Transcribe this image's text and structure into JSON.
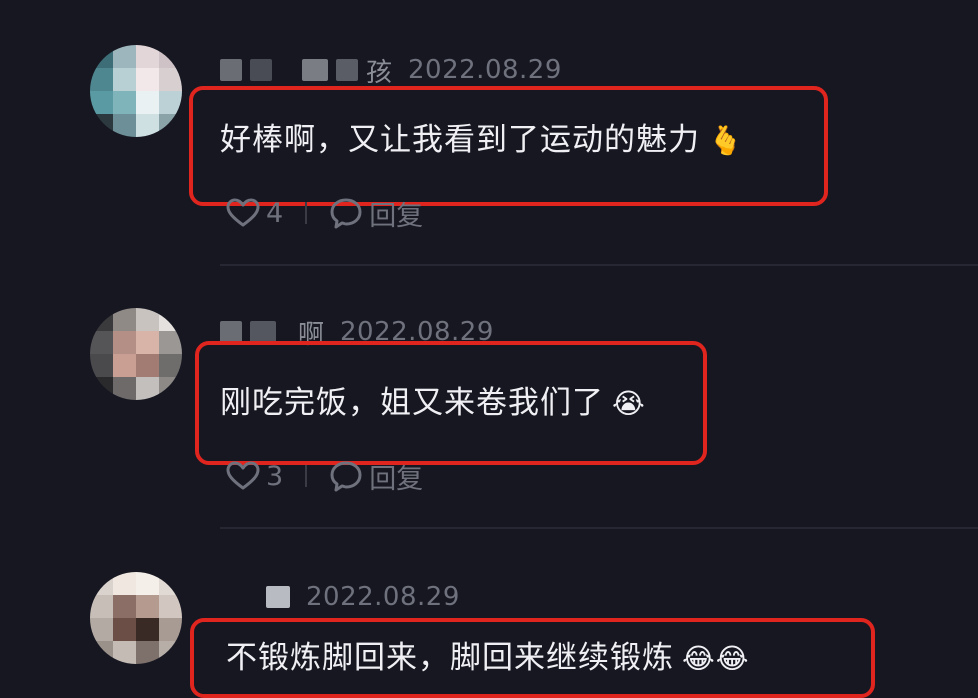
{
  "comments": [
    {
      "username_visible": "孩",
      "date": "2022.08.29",
      "text": "好棒啊，又让我看到了运动的魅力",
      "emoji": "🫰",
      "likes": "4",
      "reply_label": "回复"
    },
    {
      "username_visible": "啊",
      "date": "2022.08.29",
      "text": "刚吃完饭，姐又来卷我们了",
      "emoji": "😭",
      "likes": "3",
      "reply_label": "回复"
    },
    {
      "username_visible": "",
      "date": "2022.08.29",
      "text": "不锻炼脚回来，脚回来继续锻炼",
      "emoji": "😂😂"
    }
  ],
  "colors": {
    "background": "#161721",
    "highlight_border": "#e0251f",
    "muted_text": "#6f717c"
  },
  "icons": [
    "heart-icon",
    "comment-bubble-icon"
  ]
}
